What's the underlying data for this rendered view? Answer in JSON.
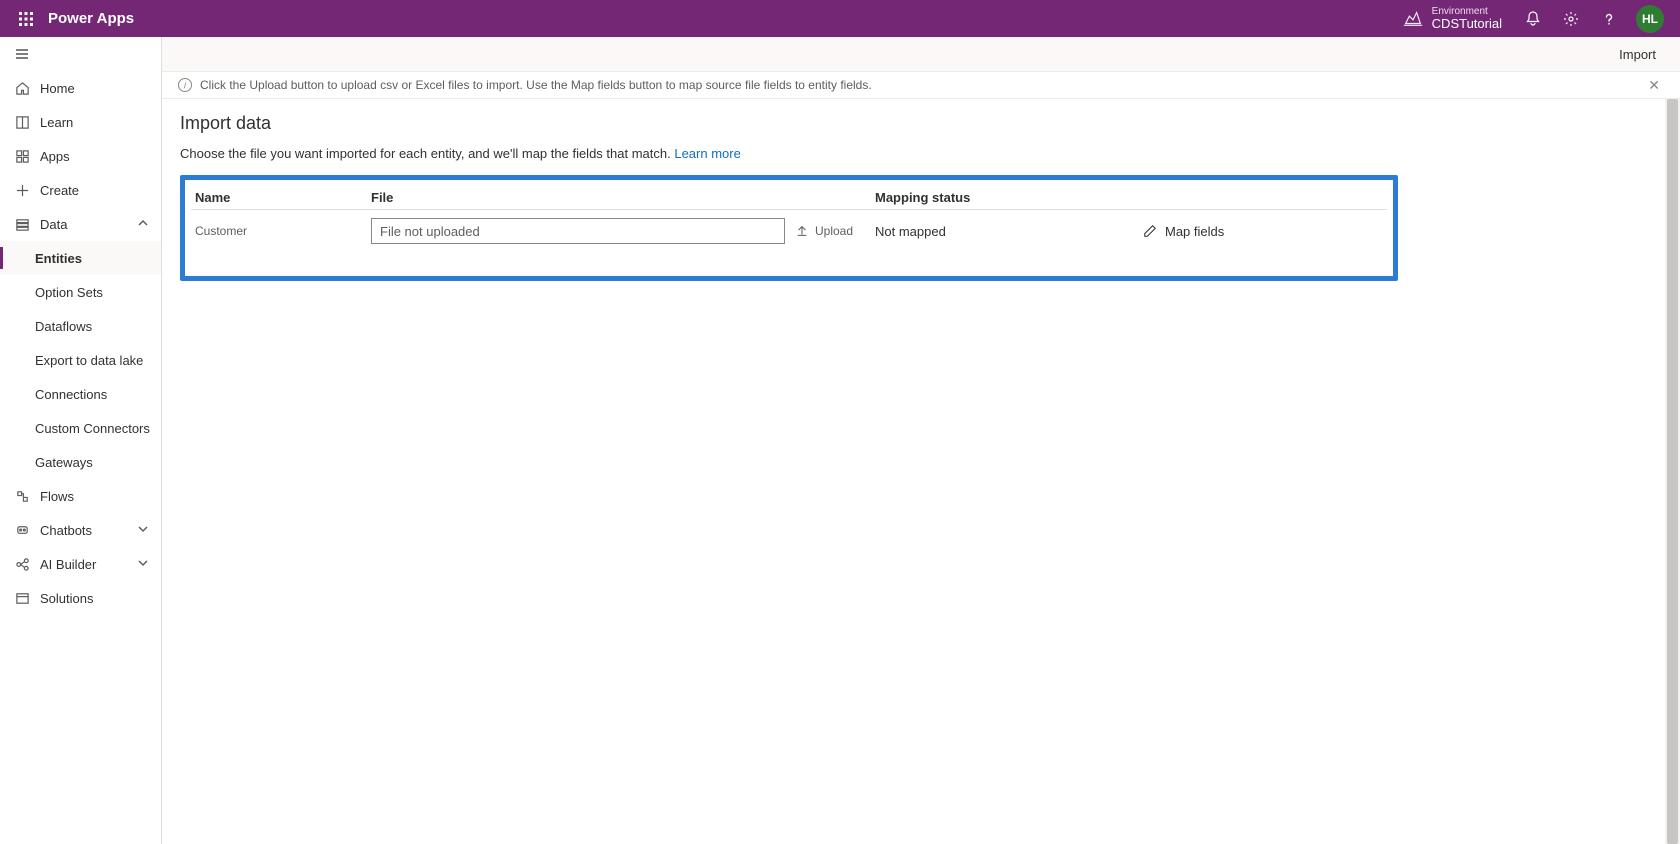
{
  "topbar": {
    "product": "Power Apps",
    "env_label": "Environment",
    "env_name": "CDSTutorial",
    "avatar_initials": "HL"
  },
  "sidebar": {
    "items": {
      "home": "Home",
      "learn": "Learn",
      "apps": "Apps",
      "create": "Create",
      "data": "Data",
      "entities": "Entities",
      "option_sets": "Option Sets",
      "dataflows": "Dataflows",
      "export_lake": "Export to data lake",
      "connections": "Connections",
      "custom_connectors": "Custom Connectors",
      "gateways": "Gateways",
      "flows": "Flows",
      "chatbots": "Chatbots",
      "ai_builder": "AI Builder",
      "solutions": "Solutions"
    }
  },
  "commandbar": {
    "import": "Import"
  },
  "infobar": {
    "text": "Click the Upload button to upload csv or Excel files to import. Use the Map fields button to map source file fields to entity fields."
  },
  "page": {
    "title": "Import data",
    "description": "Choose the file you want imported for each entity, and we'll map the fields that match. ",
    "learn_more": "Learn more"
  },
  "grid": {
    "headers": {
      "name": "Name",
      "file": "File",
      "status": "Mapping status"
    },
    "row": {
      "name": "Customer",
      "file_placeholder": "File not uploaded",
      "upload_label": "Upload",
      "status": "Not mapped",
      "map_label": "Map fields"
    }
  }
}
